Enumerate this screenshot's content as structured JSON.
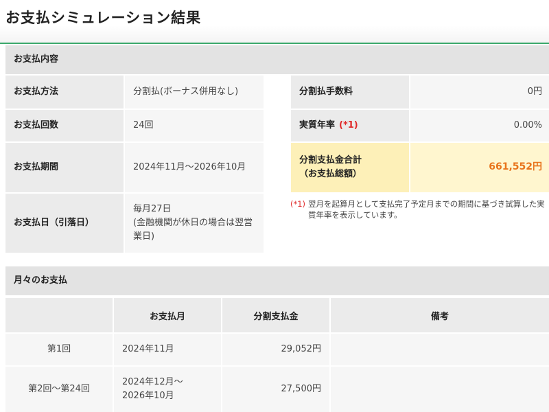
{
  "page": {
    "title": "お支払シミュレーション結果"
  },
  "payment_details": {
    "section_title": "お支払内容",
    "left_rows": [
      {
        "label": "お支払方法",
        "value": "分割払(ボーナス併用なし)"
      },
      {
        "label": "お支払回数",
        "value": "24回"
      },
      {
        "label": "お支払期間",
        "value": "2024年11月～2026年10月"
      },
      {
        "label": "お支払日（引落日）",
        "value": "毎月27日\n(金融機関が休日の場合は翌営業日)"
      }
    ],
    "fee_label": "分割払手数料",
    "fee_value": "0円",
    "rate_label": "実質年率",
    "rate_mark": "(*1)",
    "rate_value": "0.00%",
    "total_label_1": "分割支払金合計",
    "total_label_2": "（お支払総額）",
    "total_value": "661,552円",
    "note_mark": "(*1)",
    "note_text": "翌月を起算月として支払完了予定月までの期間に基づき試算した実質年率を表示しています。"
  },
  "monthly": {
    "section_title": "月々のお支払",
    "columns": [
      "",
      "お支払月",
      "分割支払金",
      "備考"
    ],
    "rows": [
      {
        "no": "第1回",
        "month": "2024年11月",
        "amount": "29,052円",
        "remarks": ""
      },
      {
        "no": "第2回～第24回",
        "month": "2024年12月～\n2026年10月",
        "amount": "27,500円",
        "remarks": ""
      }
    ]
  },
  "colors": {
    "accent_line": "#3aa86b",
    "highlight_bg": "#fff6cf",
    "total_amount": "#e8741c",
    "note_mark": "#e02a2a"
  }
}
